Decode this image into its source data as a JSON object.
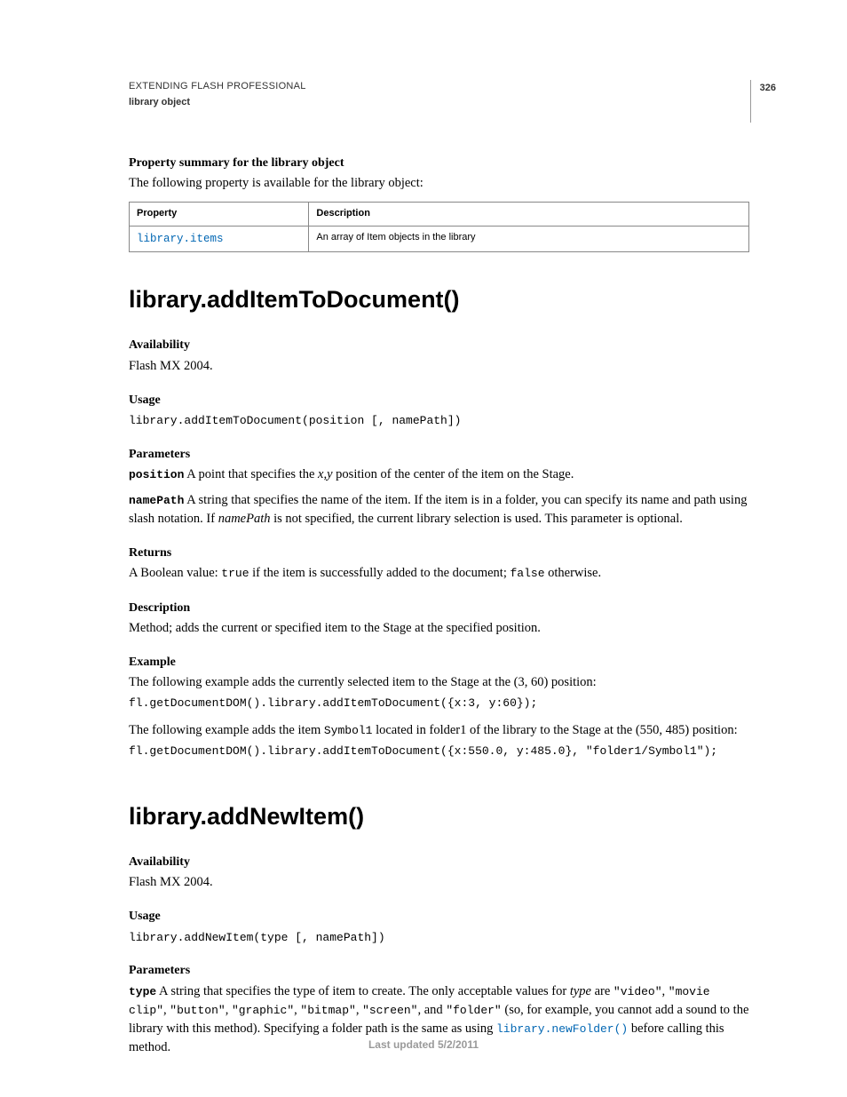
{
  "header": {
    "line1": "EXTENDING FLASH PROFESSIONAL",
    "line2": "library object",
    "page_number": "326"
  },
  "prop_summary": {
    "heading": "Property summary for the library object",
    "intro": "The following property is available for the library object:",
    "table": {
      "col1_header": "Property",
      "col2_header": "Description",
      "rows": [
        {
          "prop": "library.items",
          "desc": "An array of Item objects in the library"
        }
      ]
    }
  },
  "method1": {
    "title": "library.addItemToDocument()",
    "availability_h": "Availability",
    "availability_t": "Flash MX 2004.",
    "usage_h": "Usage",
    "usage_code": "library.addItemToDocument(position [, namePath])",
    "parameters_h": "Parameters",
    "param1_name": "position",
    "param1_desc_a": "  A point that specifies the ",
    "param1_desc_xy": "x,y",
    "param1_desc_b": " position of the center of the item on the Stage.",
    "param2_name": "namePath",
    "param2_desc_a": "  A string that specifies the name of the item. If the item is in a folder, you can specify its name and path using slash notation. If ",
    "param2_desc_np": "namePath",
    "param2_desc_b": " is not specified, the current library selection is used. This parameter is optional.",
    "returns_h": "Returns",
    "returns_a": "A Boolean value: ",
    "returns_true": "true",
    "returns_b": " if the item is successfully added to the document; ",
    "returns_false": "false",
    "returns_c": " otherwise.",
    "description_h": "Description",
    "description_t": "Method; adds the current or specified item to the Stage at the specified position.",
    "example_h": "Example",
    "example_intro1": "The following example adds the currently selected item to the Stage at the (3, 60) position:",
    "example_code1": "fl.getDocumentDOM().library.addItemToDocument({x:3, y:60});",
    "example_intro2": "The following example adds the item ",
    "example_sym": "Symbol1",
    "example_intro2b": " located in folder1 of the library to the Stage at the (550, 485) position:",
    "example_code2": "fl.getDocumentDOM().library.addItemToDocument({x:550.0, y:485.0}, \"folder1/Symbol1\");"
  },
  "method2": {
    "title": "library.addNewItem()",
    "availability_h": "Availability",
    "availability_t": "Flash MX 2004.",
    "usage_h": "Usage",
    "usage_code": "library.addNewItem(type [, namePath])",
    "parameters_h": "Parameters",
    "param1_name": "type",
    "p1a": " A string that specifies the type of item to create. The only acceptable values for ",
    "p1_type": "type",
    "p1b": " are ",
    "v1": "\"video\"",
    "p1c": ", ",
    "v2": "\"movie clip\"",
    "p1d": ", ",
    "v3": "\"button\"",
    "p1e": ", ",
    "v4": "\"graphic\"",
    "p1f": ", ",
    "v5": "\"bitmap\"",
    "p1g": ", ",
    "v6": "\"screen\"",
    "p1h": ", and ",
    "v7": "\"folder\"",
    "p1i": " (so, for example, you cannot add a sound to the library with this method). Specifying a folder path is the same as using ",
    "link1": "library.newFolder()",
    "p1j": " before calling this method."
  },
  "footer": "Last updated 5/2/2011"
}
